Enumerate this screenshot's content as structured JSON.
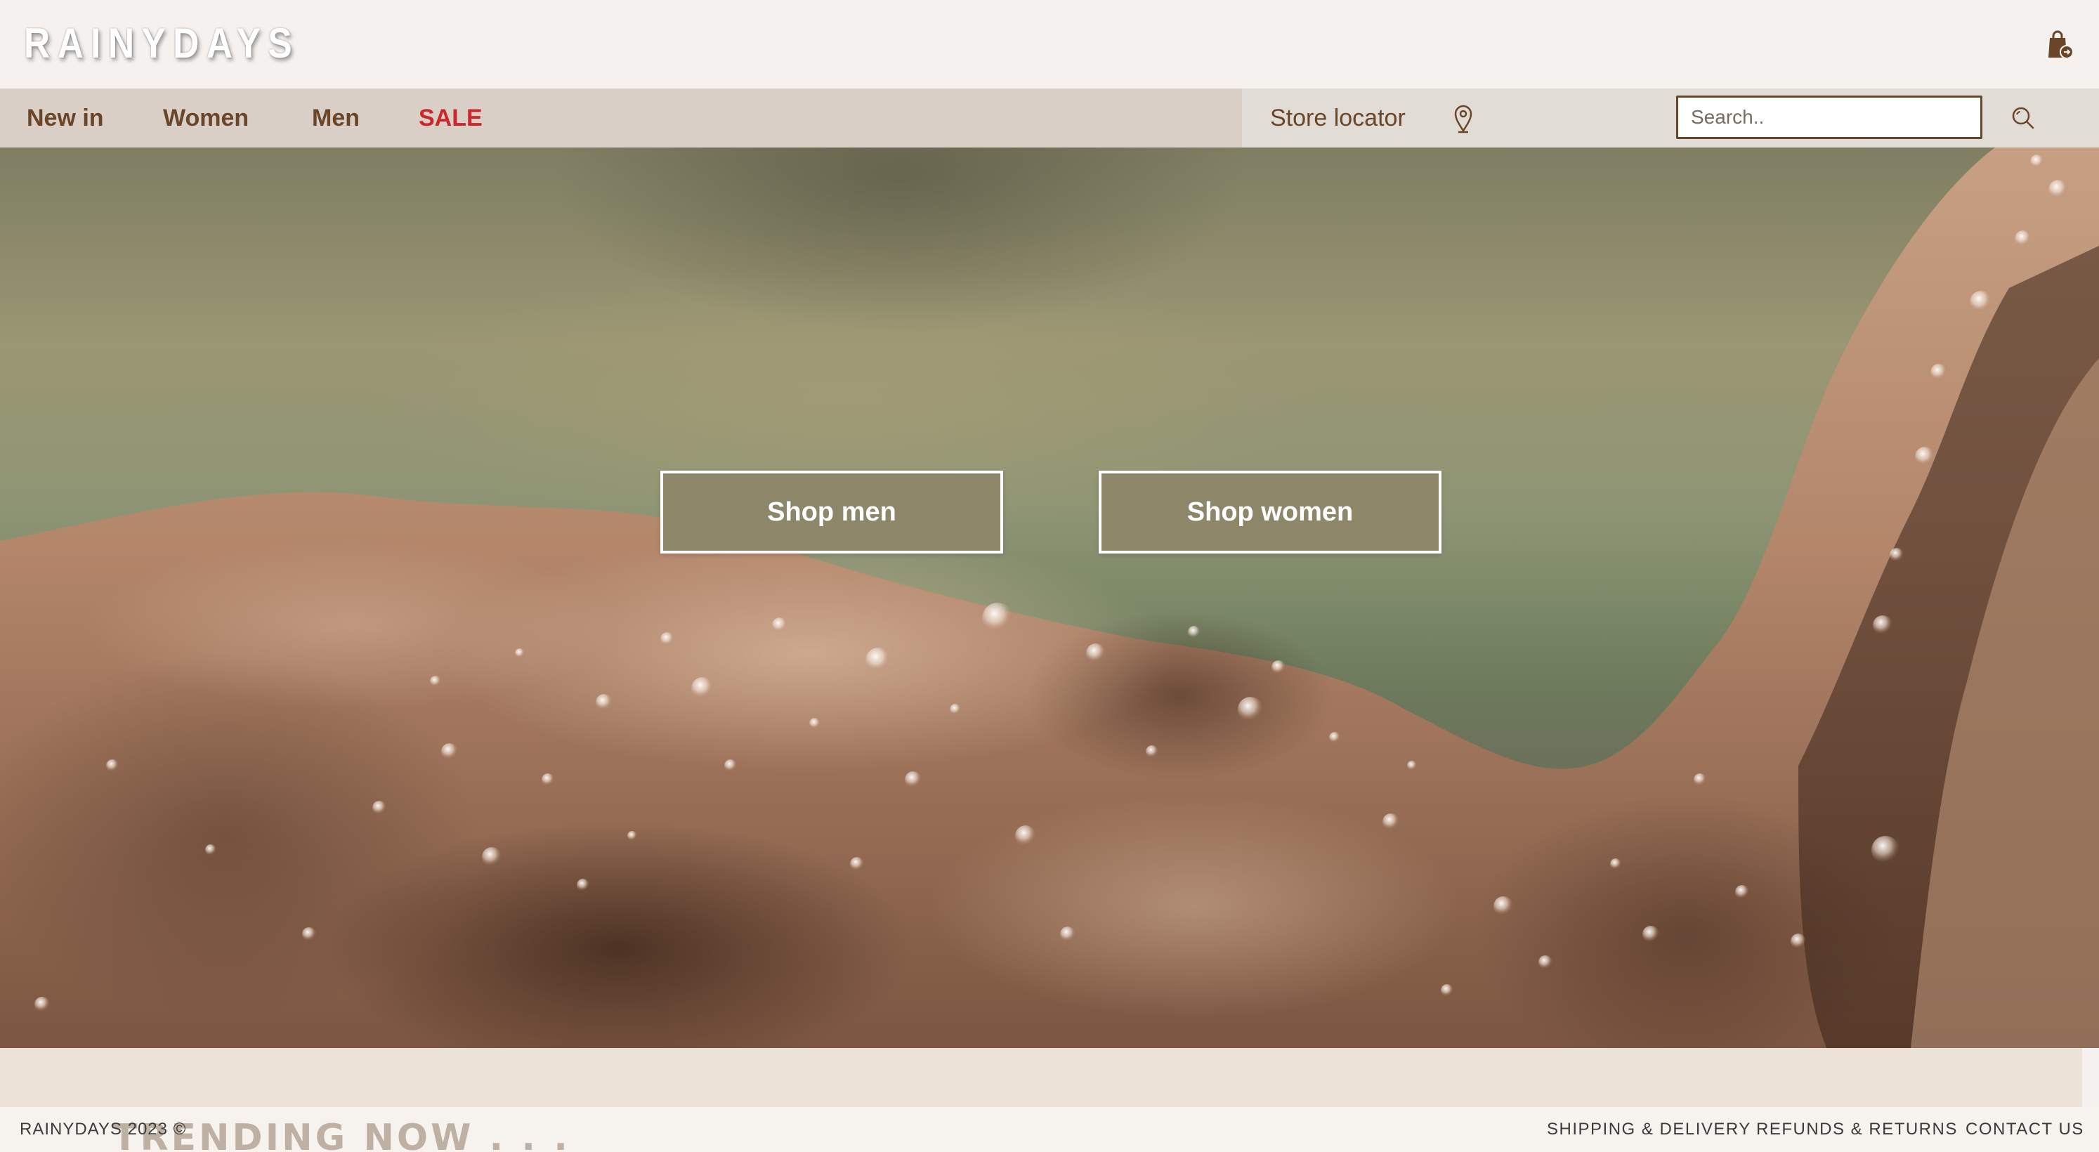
{
  "header": {
    "logo_text": "RAINYDAYS",
    "cart_icon": "shopping-bag-icon"
  },
  "nav": {
    "items": [
      {
        "label": "New in"
      },
      {
        "label": "Women"
      },
      {
        "label": "Men"
      },
      {
        "label": "SALE"
      }
    ],
    "store_locator_label": "Store locator",
    "store_locator_icon": "map-pin-icon",
    "search": {
      "placeholder": "Search..",
      "value": "",
      "icon": "search-icon"
    }
  },
  "hero": {
    "shop_men_label": "Shop men",
    "shop_women_label": "Shop women"
  },
  "trending": {
    "heading": "TRENDING NOW . . ."
  },
  "footer": {
    "copyright": "RAINYDAYS 2023 ©",
    "links": [
      {
        "label": "SHIPPING & DELIVERY"
      },
      {
        "label": "REFUNDS & RETURNS"
      },
      {
        "label": "CONTACT US"
      }
    ]
  },
  "colors": {
    "brand_brown": "#6b4528",
    "sale_red": "#c9272c",
    "nav_bg": "#d9cfc7",
    "button_bg": "#8e8669",
    "page_bg": "#f4f1ee"
  }
}
